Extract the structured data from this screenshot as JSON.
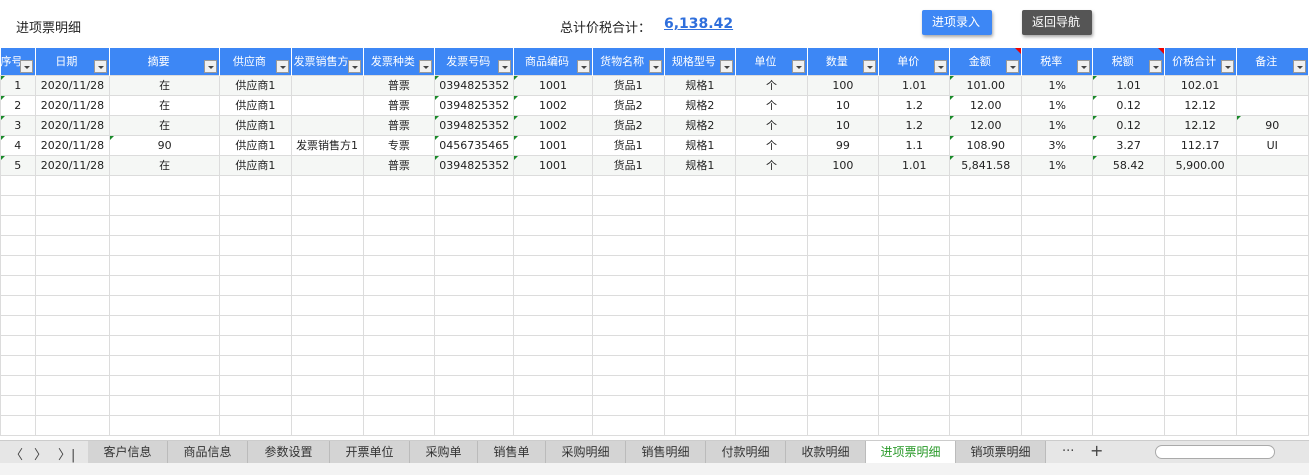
{
  "header": {
    "title": "进项票明细",
    "total_label": "总计价税合计：",
    "total_value": "6,138.42",
    "btn_entry": "进项录入",
    "btn_back": "返回导航"
  },
  "columns": [
    "序号",
    "日期",
    "摘要",
    "供应商",
    "发票销售方",
    "发票种类",
    "发票号码",
    "商品编码",
    "货物名称",
    "规格型号",
    "单位",
    "数量",
    "单价",
    "金额",
    "税率",
    "税额",
    "价税合计",
    "备注"
  ],
  "rows": [
    [
      "1",
      "2020/11/28",
      "在",
      "供应商1",
      "",
      "普票",
      "0394825352",
      "1001",
      "货品1",
      "规格1",
      "个",
      "100",
      "1.01",
      "101.00",
      "1%",
      "1.01",
      "102.01",
      ""
    ],
    [
      "2",
      "2020/11/28",
      "在",
      "供应商1",
      "",
      "普票",
      "0394825352",
      "1002",
      "货品2",
      "规格2",
      "个",
      "10",
      "1.2",
      "12.00",
      "1%",
      "0.12",
      "12.12",
      ""
    ],
    [
      "3",
      "2020/11/28",
      "在",
      "供应商1",
      "",
      "普票",
      "0394825352",
      "1002",
      "货品2",
      "规格2",
      "个",
      "10",
      "1.2",
      "12.00",
      "1%",
      "0.12",
      "12.12",
      "90"
    ],
    [
      "4",
      "2020/11/28",
      "90",
      "供应商1",
      "发票销售方1",
      "专票",
      "0456735465",
      "1001",
      "货品1",
      "规格1",
      "个",
      "99",
      "1.1",
      "108.90",
      "3%",
      "3.27",
      "112.17",
      "UI"
    ],
    [
      "5",
      "2020/11/28",
      "在",
      "供应商1",
      "",
      "普票",
      "0394825352",
      "1001",
      "货品1",
      "规格1",
      "个",
      "100",
      "1.01",
      "5,841.58",
      "1%",
      "58.42",
      "5,900.00",
      ""
    ]
  ],
  "sheet_tabs": [
    "客户信息",
    "商品信息",
    "参数设置",
    "开票单位",
    "采购单",
    "销售单",
    "采购明细",
    "销售明细",
    "付款明细",
    "收款明细",
    "进项票明细",
    "销项票明细"
  ],
  "active_tab": "进项票明细",
  "tab_nav": {
    "first": "〈",
    "next": "〉",
    "last": "〉|",
    "more": "···",
    "add": "+"
  }
}
